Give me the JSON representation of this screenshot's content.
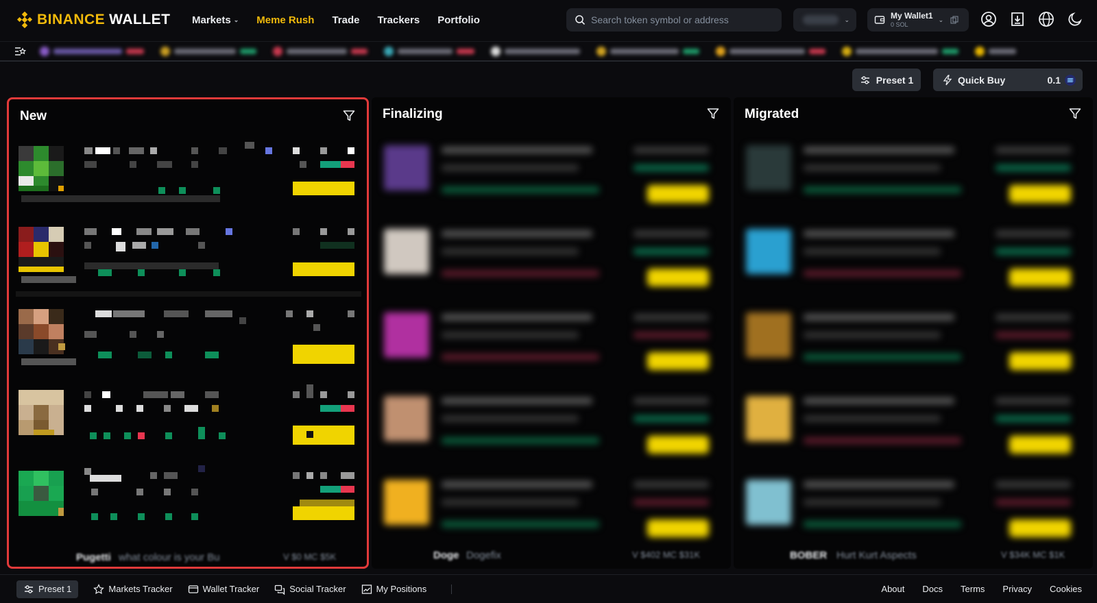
{
  "brand": {
    "name": "BINANCE",
    "product": "WALLET",
    "accent": "#f0b90b"
  },
  "nav": {
    "items": [
      {
        "label": "Markets",
        "has_dropdown": true
      },
      {
        "label": "Meme Rush",
        "active": true
      },
      {
        "label": "Trade"
      },
      {
        "label": "Trackers"
      },
      {
        "label": "Portfolio"
      }
    ]
  },
  "search": {
    "placeholder": "Search token symbol or address"
  },
  "wallet": {
    "name": "My Wallet1",
    "balance": "0 SOL"
  },
  "toolbar": {
    "preset_label": "Preset 1",
    "quick_buy_label": "Quick Buy",
    "quick_buy_amount": "0.1"
  },
  "columns": [
    {
      "title": "New",
      "highlighted": true
    },
    {
      "title": "Finalizing"
    },
    {
      "title": "Migrated"
    }
  ],
  "peek": {
    "new": {
      "name": "Pugetti",
      "desc": "what colour is your Bu",
      "stats": "V $0 MC $5K"
    },
    "finalizing": {
      "name": "Doge",
      "desc": "Dogefix",
      "stats": "V $402 MC $31K"
    },
    "migrated": {
      "name": "BOBER",
      "desc": "Hurt Kurt Aspects",
      "stats": "V $34K MC $1K"
    }
  },
  "footer": {
    "left": [
      {
        "label": "Preset 1",
        "icon": "sliders-icon"
      },
      {
        "label": "Markets Tracker",
        "icon": "star-icon"
      },
      {
        "label": "Wallet Tracker",
        "icon": "wallet-icon"
      },
      {
        "label": "Social Tracker",
        "icon": "chat-icon"
      },
      {
        "label": "My Positions",
        "icon": "chart-icon"
      }
    ],
    "right": [
      "About",
      "Docs",
      "Terms",
      "Privacy",
      "Cookies"
    ]
  },
  "colors": {
    "buy_button": "#f0d400",
    "positive": "#0ecb81",
    "negative": "#f6465d",
    "highlight_border": "#e23a3a"
  }
}
